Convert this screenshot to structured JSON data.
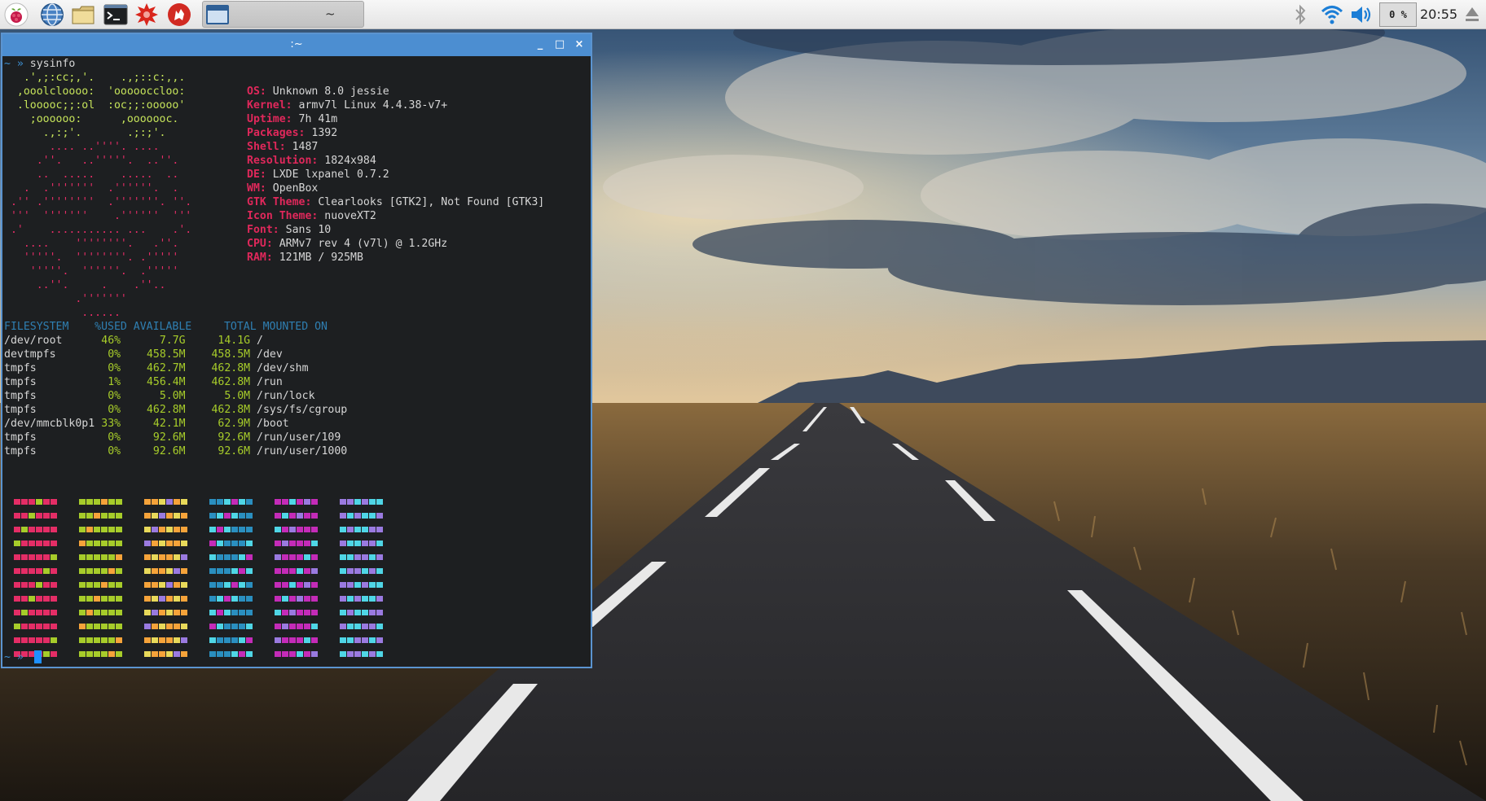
{
  "panel": {
    "launchers": [
      {
        "name": "raspberry-menu-icon"
      },
      {
        "name": "web-browser-icon"
      },
      {
        "name": "file-manager-icon"
      },
      {
        "name": "terminal-icon"
      },
      {
        "name": "mathematica-icon"
      },
      {
        "name": "wolfram-icon"
      }
    ],
    "task_button_label": "~",
    "cpu_usage": "0 %",
    "clock": "20:55",
    "tray_icons": [
      "bluetooth-icon",
      "wifi-icon",
      "volume-icon",
      "eject-icon"
    ]
  },
  "window": {
    "title": ":~",
    "minimize": "_",
    "maximize": "□",
    "close": "×"
  },
  "terminal": {
    "prompt": "~ »",
    "command": "sysinfo",
    "logo_lines": [
      "   .',;:cc;,'.    .,;::c:,,.",
      "  ,ooolcloooo:  'oooooccloo:",
      "  .looooc;;:ol  :oc;;:ooooo'",
      "    ;oooooo:      ,ooooooc.",
      "      .,:;'.       .;:;'.",
      "       .... ..''''. ....",
      "     .''.   ..'''''.  ..''.",
      "     ..  .....    .....  ..",
      "   .  .'''''''  .''''''.  .",
      " .'' .''''''''  .'''''''. ''.",
      " '''  '''''''    .''''''  '''",
      " .'    ........... ...    .'.",
      "   ....    ''''''''.   .''.",
      "   '''''.  ''''''''. .'''''",
      "    '''''.  ''''''.  .'''''",
      "     ..''.     .    .''..",
      "           .'''''''",
      "            ......"
    ],
    "info": [
      {
        "key": "OS:",
        "value": "Unknown 8.0 jessie"
      },
      {
        "key": "Kernel:",
        "value": "armv7l Linux 4.4.38-v7+"
      },
      {
        "key": "Uptime:",
        "value": "7h 41m"
      },
      {
        "key": "Packages:",
        "value": "1392"
      },
      {
        "key": "Shell:",
        "value": "1487"
      },
      {
        "key": "Resolution:",
        "value": "1824x984"
      },
      {
        "key": "DE:",
        "value": "LXDE lxpanel 0.7.2"
      },
      {
        "key": "WM:",
        "value": "OpenBox"
      },
      {
        "key": "GTK Theme:",
        "value": "Clearlooks [GTK2], Not Found [GTK3]"
      },
      {
        "key": "Icon Theme:",
        "value": "nuoveXT2"
      },
      {
        "key": "Font:",
        "value": "Sans 10"
      },
      {
        "key": "CPU:",
        "value": "ARMv7 rev 4 (v7l) @ 1.2GHz"
      },
      {
        "key": "RAM:",
        "value": "121MB / 925MB"
      }
    ],
    "df_header": "FILESYSTEM    %USED AVAILABLE     TOTAL MOUNTED ON",
    "df_rows": [
      {
        "fs": "/dev/root",
        "used": "46%",
        "avail": "7.7G",
        "total": "14.1G",
        "mount": "/"
      },
      {
        "fs": "devtmpfs",
        "used": "0%",
        "avail": "458.5M",
        "total": "458.5M",
        "mount": "/dev"
      },
      {
        "fs": "tmpfs",
        "used": "0%",
        "avail": "462.7M",
        "total": "462.8M",
        "mount": "/dev/shm"
      },
      {
        "fs": "tmpfs",
        "used": "1%",
        "avail": "456.4M",
        "total": "462.8M",
        "mount": "/run"
      },
      {
        "fs": "tmpfs",
        "used": "0%",
        "avail": "5.0M",
        "total": "5.0M",
        "mount": "/run/lock"
      },
      {
        "fs": "tmpfs",
        "used": "0%",
        "avail": "462.8M",
        "total": "462.8M",
        "mount": "/sys/fs/cgroup"
      },
      {
        "fs": "/dev/mmcblk0p1",
        "used": "33%",
        "avail": "42.1M",
        "total": "62.9M",
        "mount": "/boot"
      },
      {
        "fs": "tmpfs",
        "used": "0%",
        "avail": "92.6M",
        "total": "92.6M",
        "mount": "/run/user/109"
      },
      {
        "fs": "tmpfs",
        "used": "0%",
        "avail": "92.6M",
        "total": "92.6M",
        "mount": "/run/user/1000"
      }
    ],
    "palette": [
      "#e42d66",
      "#a7cc2a",
      "#f6a33a",
      "#2a8fc0",
      "#c42bb8",
      "#9a7ae0",
      "#4fd6e6",
      "#e8d95a",
      "#6a6ae0"
    ]
  }
}
